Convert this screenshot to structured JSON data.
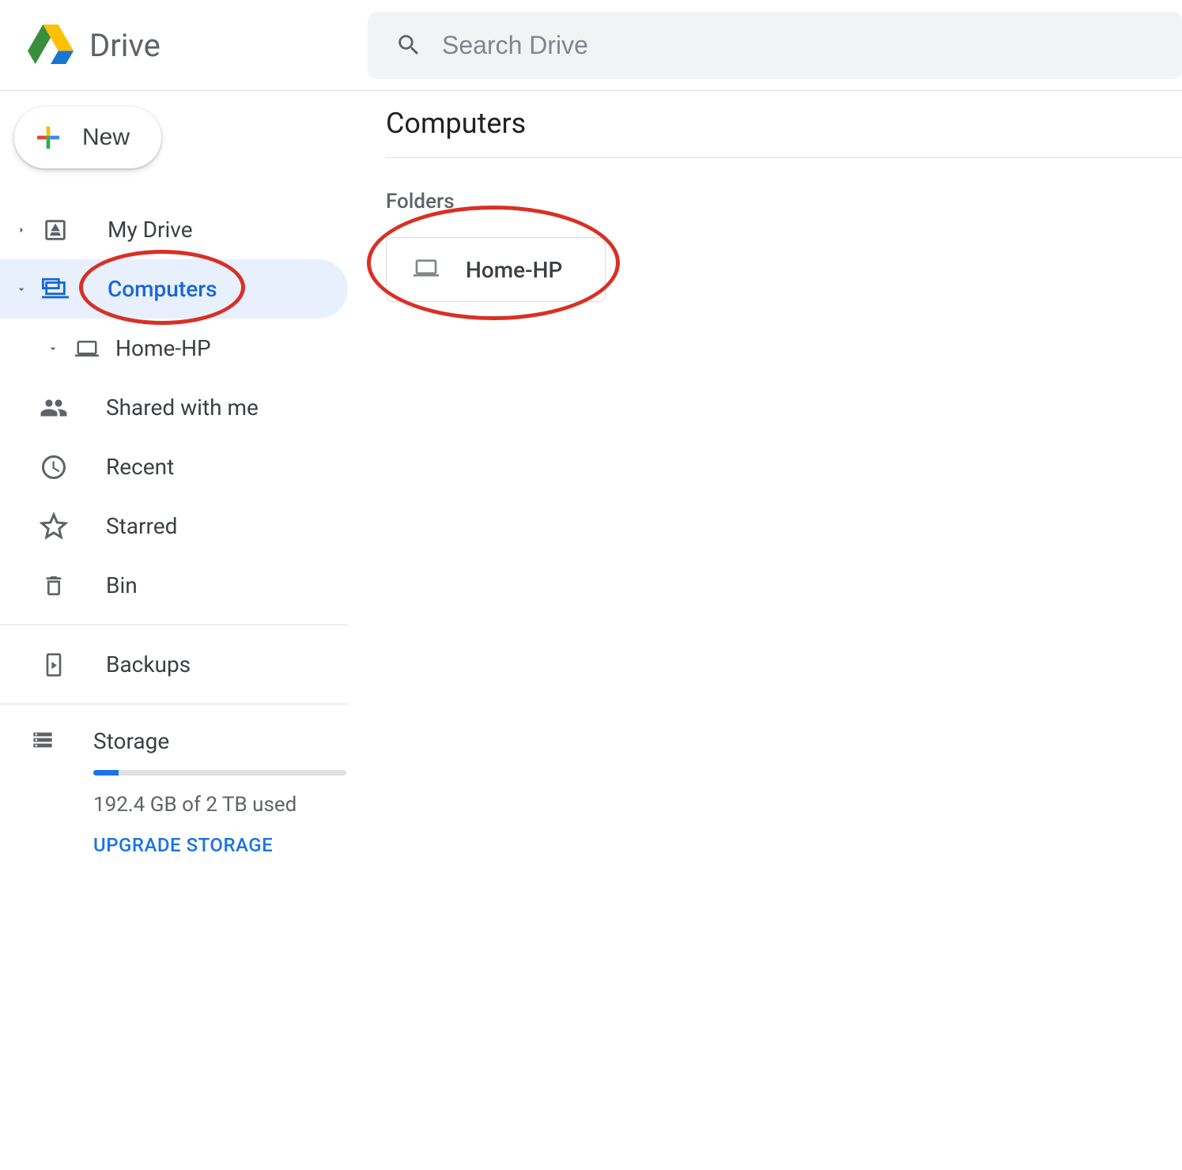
{
  "header": {
    "app_name": "Drive",
    "search_placeholder": "Search Drive"
  },
  "new_button_label": "New",
  "sidebar": {
    "items": [
      {
        "label": "My Drive",
        "icon": "mydrive-icon",
        "expanded": false
      },
      {
        "label": "Computers",
        "icon": "computer-icon",
        "expanded": true,
        "selected": true
      },
      {
        "label": "Home-HP",
        "icon": "laptop-icon",
        "expanded": true,
        "indent": true
      },
      {
        "label": "Shared with me",
        "icon": "shared-icon"
      },
      {
        "label": "Recent",
        "icon": "clock-icon"
      },
      {
        "label": "Starred",
        "icon": "star-icon"
      },
      {
        "label": "Bin",
        "icon": "trash-icon"
      }
    ],
    "backups_label": "Backups"
  },
  "storage": {
    "title": "Storage",
    "used_text": "192.4 GB of 2 TB used",
    "upgrade_label": "UPGRADE STORAGE",
    "fill_percent": 10
  },
  "main": {
    "page_title": "Computers",
    "section_label": "Folders",
    "folders": [
      {
        "label": "Home-HP",
        "icon": "laptop-icon"
      }
    ]
  }
}
